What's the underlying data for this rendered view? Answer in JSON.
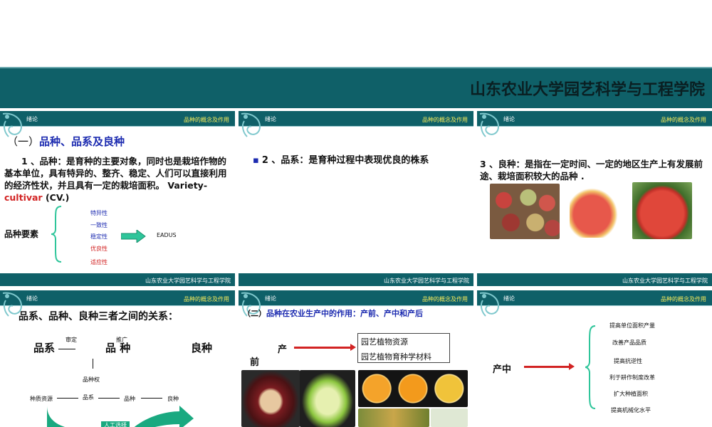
{
  "banner": {
    "title": "山东农业大学园艺科学与工程学院"
  },
  "slides": {
    "s1": {
      "header_left": "绪论",
      "header_right": "品种的概念及作用",
      "heading_prefix": "（一）",
      "heading": "品种、品系及良种",
      "para": "1 、品种：是育种的主要对象，同时也是栽培作物的基本单位，具有特异的、整齐、稳定、人们可以直接利用的经济性状，并且具有一定的栽培面积。 Variety-",
      "para_red": "cultivar",
      "para_end": " (CV.)",
      "elements_label": "品种要素",
      "traits": [
        "特异性",
        "一致性",
        "稳定性",
        "优良性",
        "适应性"
      ],
      "abbr": "EADUS",
      "footer": "山东农业大学园艺科学与工程学院"
    },
    "s2": {
      "header_left": "绪论",
      "header_right": "品种的概念及作用",
      "bullet": "▪",
      "text": "2 、品系：是育种过程中表现优良的株系",
      "footer": "山东农业大学园艺科学与工程学院"
    },
    "s3": {
      "header_left": "绪论",
      "header_right": "品种的概念及作用",
      "text": "3 、良种：是指在一定时间、一定的地区生产上有发展前途、栽培面积较大的品种 .",
      "footer": "山东农业大学园艺科学与工程学院"
    },
    "s4": {
      "header_left": "绪论",
      "header_right": "品种的概念及作用",
      "title": "品系、品种、良种三者之间的关系：",
      "big": [
        "品系",
        "品 种",
        "良种"
      ],
      "small_top": [
        "审定",
        "推广"
      ],
      "right_label": "品种权",
      "flow": [
        "种质资源",
        "品系",
        "品种",
        "良种"
      ],
      "box_label": "人工选择"
    },
    "s5": {
      "header_left": "绪论",
      "header_right": "品种的概念及作用",
      "heading_prefix": "（二）",
      "heading": "品种在农业生产中的作用：产前、产中和产后",
      "left_char1": "产",
      "left_char2": "前",
      "box": [
        "园艺植物资源",
        "园艺植物育种学材料"
      ]
    },
    "s6": {
      "header_left": "绪论",
      "header_right": "品种的概念及作用",
      "label": "产中",
      "items": [
        "提高单位面积产量",
        "改善产品品质",
        "提高抗逆性",
        "利于耕作制度改革",
        "扩大种植面积",
        "提高机械化水平"
      ]
    }
  },
  "colors": {
    "teal": "#0f6068",
    "blue_heading": "#1c2bb0",
    "red": "#d22323",
    "accent_green": "#2ec59a"
  }
}
